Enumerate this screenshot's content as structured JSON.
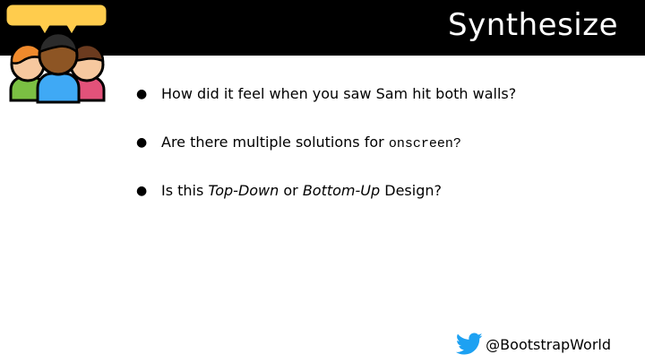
{
  "header": {
    "title": "Synthesize"
  },
  "logo": {
    "icon": "people-discussion-icon"
  },
  "bullets": [
    {
      "text": "How did it feel when you saw Sam hit both walls?"
    },
    {
      "prefix": "Are there multiple solutions for ",
      "code": "onscreen?"
    },
    {
      "prefix": "Is this ",
      "em1": "Top-Down",
      "middle": " or ",
      "em2": "Bottom-Up",
      "suffix": " Design?"
    }
  ],
  "bullet_marker": "●",
  "footer": {
    "handle": "@BootstrapWorld",
    "icon": "twitter-icon"
  },
  "colors": {
    "header_bg": "#000000",
    "title_text": "#ffffff",
    "twitter_blue": "#1DA1F2",
    "bubble_yellow": "#FFCC4D"
  }
}
